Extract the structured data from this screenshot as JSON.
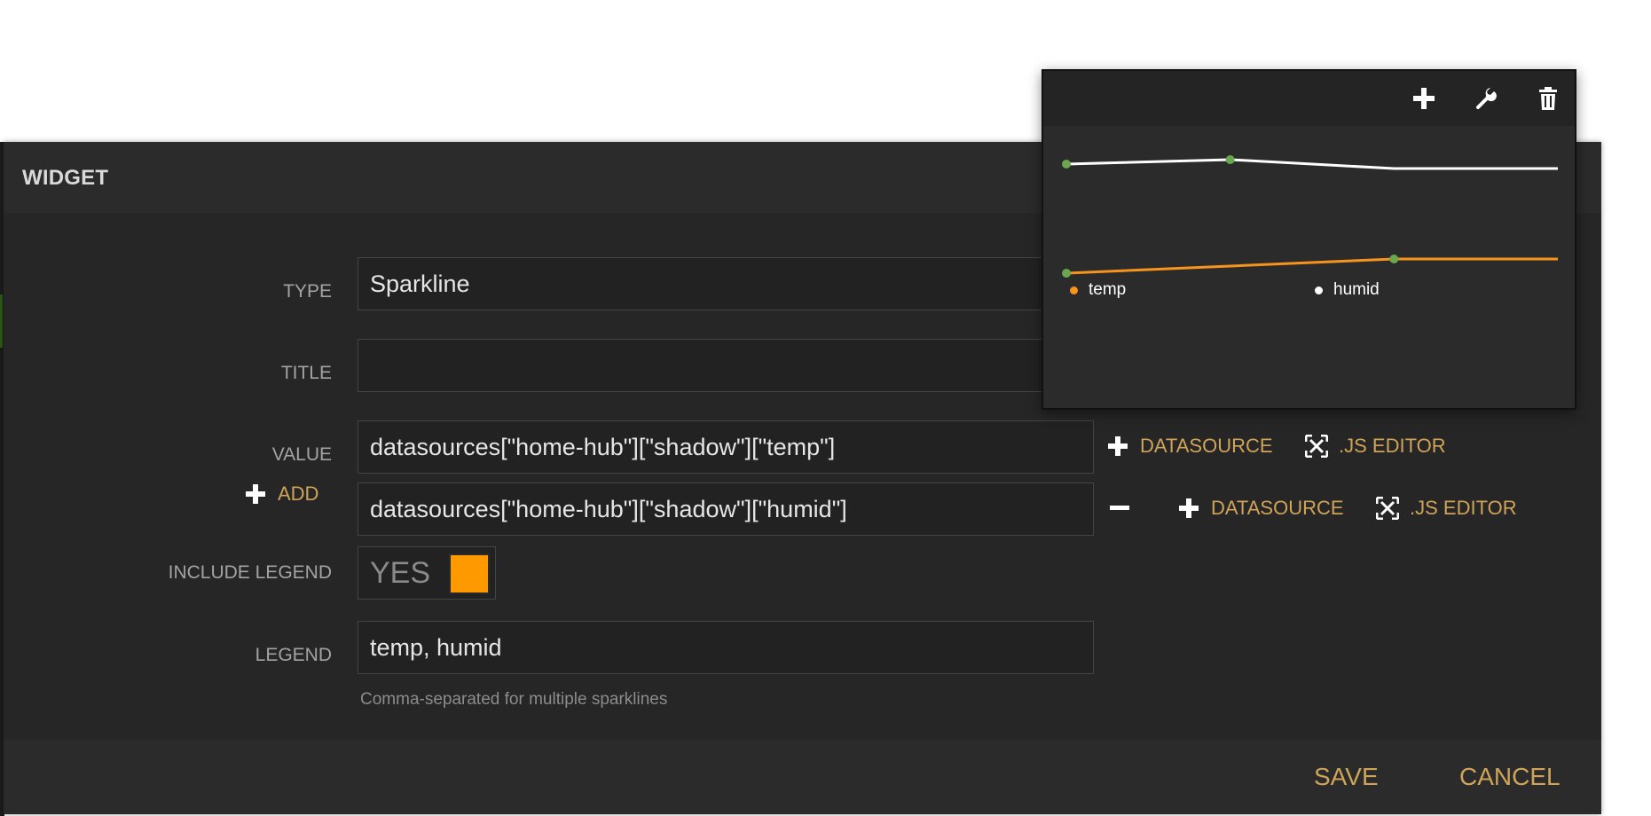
{
  "modal": {
    "title": "WIDGET"
  },
  "form": {
    "type_label": "TYPE",
    "type_value": "Sparkline",
    "title_label": "TITLE",
    "title_value": "",
    "value_label": "VALUE",
    "value_1": "datasources[\"home-hub\"][\"shadow\"][\"temp\"]",
    "value_2": "datasources[\"home-hub\"][\"shadow\"][\"humid\"]",
    "add_label": "ADD",
    "datasource_label": "DATASOURCE",
    "js_editor_label": ".JS EDITOR",
    "include_legend_label": "INCLUDE LEGEND",
    "include_legend_value": "YES",
    "legend_label": "LEGEND",
    "legend_value": "temp, humid",
    "legend_hint": "Comma-separated for multiple sparklines"
  },
  "footer": {
    "save_label": "SAVE",
    "cancel_label": "CANCEL"
  },
  "icons": {
    "plus": "plus-icon",
    "minus": "minus-icon",
    "expand": "expand-icon",
    "wrench": "wrench-icon",
    "trash": "trash-icon"
  },
  "colors": {
    "accent": "#d0a458",
    "toggle_on": "#ff9900",
    "series_temp": "#f7941d",
    "series_humid": "#ffffff",
    "marker": "#6aa84f"
  },
  "chart_data": {
    "type": "line",
    "x": [
      0,
      1,
      2,
      3
    ],
    "series": [
      {
        "name": "temp",
        "values": [
          0,
          1,
          2,
          2
        ],
        "color": "#f7941d"
      },
      {
        "name": "humid",
        "values": [
          1,
          2,
          0,
          0
        ],
        "color": "#ffffff"
      }
    ],
    "markers": {
      "temp": [
        0,
        2
      ],
      "humid": [
        0,
        1
      ]
    },
    "legend": [
      "temp",
      "humid"
    ],
    "legend_position": "bottom"
  }
}
